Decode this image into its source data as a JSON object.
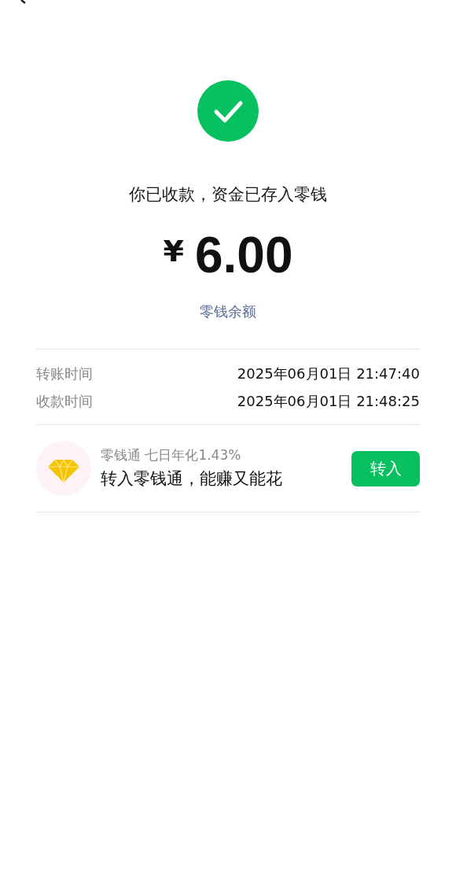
{
  "status": {
    "title": "你已收款，资金已存入零钱"
  },
  "amount": {
    "currency": "¥",
    "value": "6.00"
  },
  "balance_link": "零钱余额",
  "details": [
    {
      "label": "转账时间",
      "value": "2025年06月01日 21:47:40"
    },
    {
      "label": "收款时间",
      "value": "2025年06月01日 21:48:25"
    }
  ],
  "promo": {
    "subtitle": "零钱通 七日年化1.43%",
    "text": "转入零钱通，能赚又能花",
    "button": "转入"
  }
}
